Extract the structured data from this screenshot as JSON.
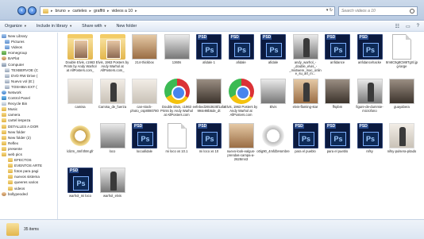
{
  "address": {
    "crumbs": [
      "",
      "bruno",
      "carteles",
      "graffiti",
      "videos a 10"
    ],
    "search_placeholder": "Search videos a 10"
  },
  "toolbar": {
    "organize": "Organize",
    "include": "Include in library",
    "share": "Share with",
    "new_folder": "New folder"
  },
  "sidebar": {
    "items": [
      "New Library",
      "Pictures",
      "Videos",
      "Homegroup",
      "BAPlat",
      "Computer",
      "TEXBERVOE (C",
      "DVD RW Drive (",
      "Nuevo vol (E:)",
      "TOSHIBA EXT (",
      "Network",
      "Control Panel",
      "Recycle Bin",
      "Music",
      "camera",
      "cartel lespeza",
      "DETALLES A DOR",
      "New folder",
      "New folder (2)",
      "Reflex",
      "presente",
      "web pics",
      "EFECTOS",
      "EVENTOS ARTE",
      "fotos para pagi",
      "nuevos sistema",
      "queeres varios",
      "videos",
      "bollypeoded"
    ]
  },
  "files": [
    {
      "name": "Double Elvis, c1963 Prints by Andy Warhol at AllPosters.com_",
      "kind": "folder"
    },
    {
      "name": "Elvis, 1963 Posters by Andy Warhol at AllPosters.com_",
      "kind": "folder"
    },
    {
      "name": "214-thickbox",
      "kind": "photo-warm"
    },
    {
      "name": "1360s",
      "kind": "photo-bw"
    },
    {
      "name": "afidale 1",
      "kind": "psd"
    },
    {
      "name": "afidale",
      "kind": "psd"
    },
    {
      "name": "afidale",
      "kind": "psd"
    },
    {
      "name": "andy_warhol_-_double_elvis_-_mixtwere_mac_online_su_art_m...",
      "kind": "photo-bw-figure"
    },
    {
      "name": "anfidance",
      "kind": "psd"
    },
    {
      "name": "anfidancehacke",
      "kind": "psd"
    },
    {
      "name": "8m6C9g8CM8TgSl.jpg-large",
      "kind": "blank"
    },
    {
      "name": "camisa",
      "kind": "photo"
    },
    {
      "name": "Camisa_de_fuerza",
      "kind": "photo-figure"
    },
    {
      "name": "can-stock-photo_csp8080780",
      "kind": "photo"
    },
    {
      "name": "Double Elvis, c1963 Prints by Andy Warhol at AllPosters.com",
      "kind": "chrome"
    },
    {
      "name": "eefebed2653635f1afa994e98b5de_dt",
      "kind": "photo-dark"
    },
    {
      "name": "Elvis, 1963 Posters by Andy Warhol at AllPosters.com",
      "kind": "chrome"
    },
    {
      "name": "Elvis",
      "kind": "photo-bw"
    },
    {
      "name": "elvis-flaming-star",
      "kind": "photo-warm-figure"
    },
    {
      "name": "ffspbm",
      "kind": "photo-dark"
    },
    {
      "name": "figure-de-dummie-microfono",
      "kind": "photo-bw-figure"
    },
    {
      "name": "guayabera",
      "kind": "photo-dark"
    },
    {
      "name": "ldizm_4mf4hM.gfr",
      "kind": "gold"
    },
    {
      "name": "loco",
      "kind": "photo-bw"
    },
    {
      "name": "locoafidale",
      "kind": "psd"
    },
    {
      "name": "mi loco xs 10.1",
      "kind": "blank"
    },
    {
      "name": "mi loco xs 10",
      "kind": "psd"
    },
    {
      "name": "nuevo-look-ealgus-prendas-campa-a-2628mn3",
      "kind": "photo-warm"
    },
    {
      "name": "o0ig90_4mfdbHombre",
      "kind": "ring"
    },
    {
      "name": "para el pueblo",
      "kind": "psd"
    },
    {
      "name": "para el pueblo",
      "kind": "psd"
    },
    {
      "name": "nifsy",
      "kind": "psd"
    },
    {
      "name": "nifsy-pulsera-pitado",
      "kind": "photo-figure"
    },
    {
      "name": "warhol_mi loco",
      "kind": "psd"
    },
    {
      "name": "warhol_elvis",
      "kind": "photo-bw-figure"
    }
  ],
  "status": {
    "count": "35 items"
  }
}
